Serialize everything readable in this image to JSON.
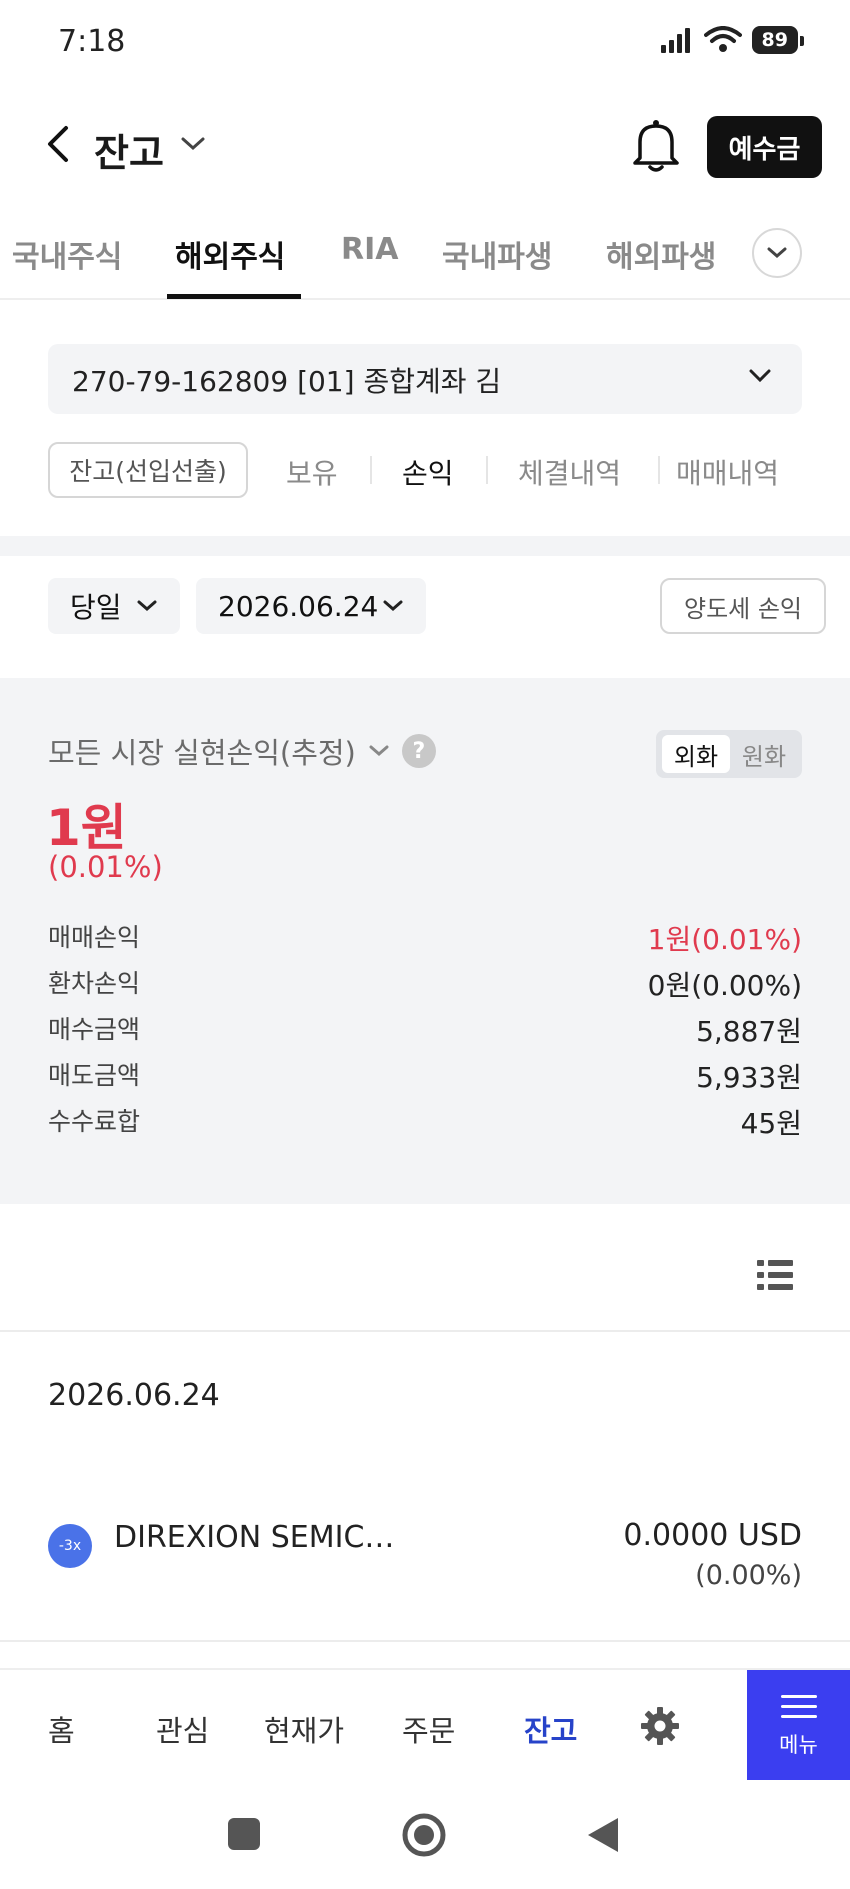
{
  "status_bar": {
    "time": "7:18",
    "battery": "89"
  },
  "header": {
    "title": "잔고",
    "deposit_button": "예수금"
  },
  "tabs": [
    {
      "label": "국내주식",
      "active": false
    },
    {
      "label": "해외주식",
      "active": true
    },
    {
      "label": "RIA",
      "active": false
    },
    {
      "label": "국내파생",
      "active": false
    },
    {
      "label": "해외파생",
      "active": false
    }
  ],
  "account": {
    "label": "270-79-162809 [01] 종합계좌 김"
  },
  "sub_tabs": {
    "pill": "잔고(선입선출)",
    "items": [
      "보유",
      "손익",
      "체결내역",
      "매매내역"
    ],
    "active": "손익"
  },
  "filters": {
    "period": "당일",
    "date": "2026.06.24",
    "tax_button": "양도세 손익"
  },
  "summary": {
    "title": "모든 시장 실현손익(추정)",
    "currency_toggle": {
      "foreign": "외화",
      "won": "원화",
      "selected": "외화"
    },
    "total": "1원",
    "total_pct": "(0.01%)",
    "rows": [
      {
        "label": "매매손익",
        "value": "1원(0.01%)",
        "highlight": true
      },
      {
        "label": "환차손익",
        "value": "0원(0.00%)",
        "highlight": false
      },
      {
        "label": "매수금액",
        "value": "5,887원",
        "highlight": false
      },
      {
        "label": "매도금액",
        "value": "5,933원",
        "highlight": false
      },
      {
        "label": "수수료합",
        "value": "45원",
        "highlight": false
      }
    ]
  },
  "list": {
    "date": "2026.06.24",
    "items": [
      {
        "badge": "-3x",
        "name": "DIREXION SEMIC…",
        "value": "0.0000 USD",
        "pct": "(0.00%)"
      }
    ]
  },
  "bottom_nav": {
    "items": [
      "홈",
      "관심",
      "현재가",
      "주문",
      "잔고"
    ],
    "active": "잔고",
    "menu": "메뉴"
  },
  "colors": {
    "profit_red": "#e03a4e",
    "active_blue": "#2743c9",
    "menu_bg": "#3b3ef0"
  }
}
